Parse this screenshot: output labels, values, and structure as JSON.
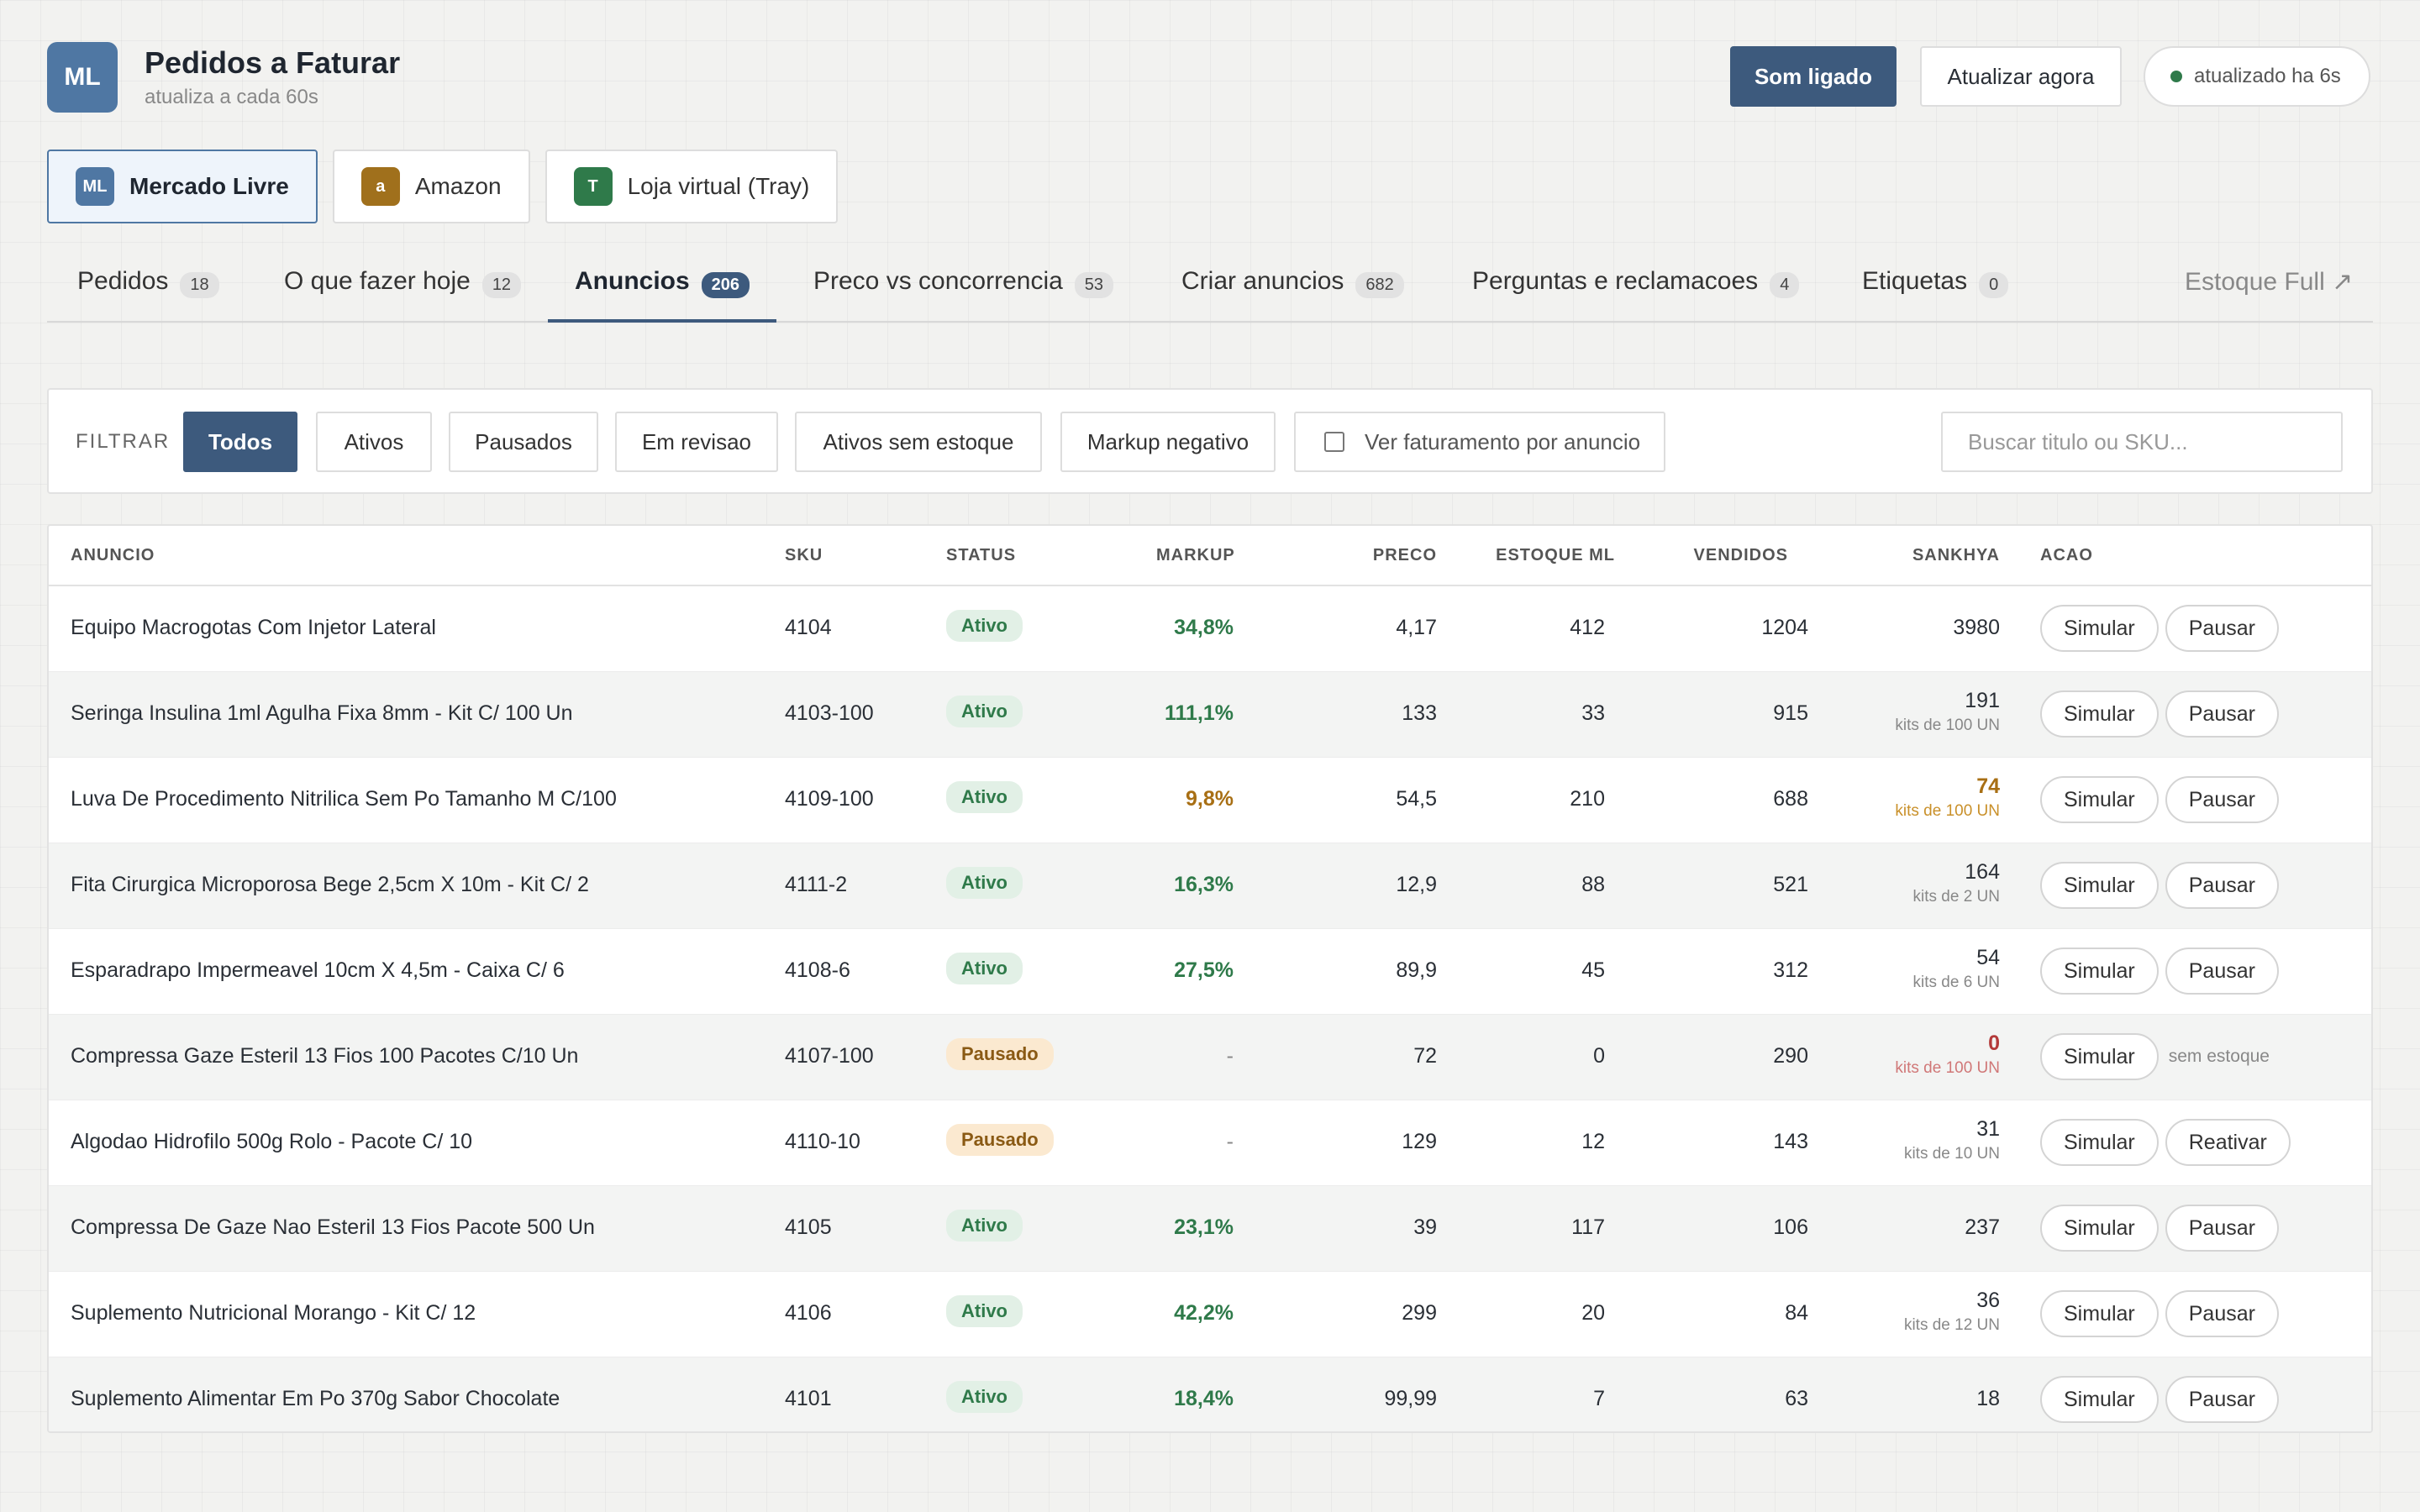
{
  "header": {
    "logo": "ML",
    "title": "Pedidos a Faturar",
    "subtitle": "atualiza a cada 60s",
    "sound_button": "Som ligado",
    "refresh_button": "Atualizar agora",
    "status_text": "atualizado ha 6s"
  },
  "marketplaces": [
    {
      "icon": "ML",
      "label": "Mercado Livre",
      "color": "#4f77a3",
      "active": true
    },
    {
      "icon": "a",
      "label": "Amazon",
      "color": "#a0701c",
      "active": false
    },
    {
      "icon": "T",
      "label": "Loja virtual (Tray)",
      "color": "#2f7a4a",
      "active": false
    }
  ],
  "tabs": [
    {
      "label": "Pedidos",
      "count": "18"
    },
    {
      "label": "O que fazer hoje",
      "count": "12"
    },
    {
      "label": "Anuncios",
      "count": "206"
    },
    {
      "label": "Preco vs concorrencia",
      "count": "53"
    },
    {
      "label": "Criar anuncios",
      "count": "682"
    },
    {
      "label": "Perguntas e reclamacoes",
      "count": "4"
    },
    {
      "label": "Etiquetas",
      "count": "0"
    },
    {
      "label": "Estoque Full ↗"
    }
  ],
  "filters": {
    "label": "FILTRAR",
    "buttons": [
      "Todos",
      "Ativos",
      "Pausados",
      "Em revisao",
      "Ativos sem estoque",
      "Markup negativo"
    ],
    "checkbox_label": "Ver faturamento por anuncio",
    "search_placeholder": "Buscar titulo ou SKU..."
  },
  "table": {
    "headers": [
      "ANUNCIO",
      "SKU",
      "STATUS",
      "MARKUP",
      "PRECO",
      "ESTOQUE ML",
      "VENDIDOS",
      "SANKHYA",
      "ACAO"
    ],
    "rows": [
      {
        "name": "Equipo Macrogotas Com Injetor Lateral",
        "sku": "4104",
        "status": "Ativo",
        "markup": "34,8%",
        "preco": "4,17",
        "estoque": "412",
        "vendidos": "1204",
        "sankhya": "3980",
        "sankhya_sub": "",
        "action1": "Simular",
        "action2": "Pausar"
      },
      {
        "name": "Seringa Insulina 1ml Agulha Fixa 8mm - Kit C/ 100 Un",
        "sku": "4103-100",
        "status": "Ativo",
        "markup": "111,1%",
        "preco": "133",
        "estoque": "33",
        "vendidos": "915",
        "sankhya": "191",
        "sankhya_sub": "kits de 100 UN",
        "action1": "Simular",
        "action2": "Pausar"
      },
      {
        "name": "Luva De Procedimento Nitrilica Sem Po Tamanho M C/100",
        "sku": "4109-100",
        "status": "Ativo",
        "markup": "9,8%",
        "preco": "54,5",
        "estoque": "210",
        "vendidos": "688",
        "sankhya": "74",
        "sankhya_sub": "kits de 100 UN",
        "action1": "Simular",
        "action2": "Pausar"
      },
      {
        "name": "Fita Cirurgica Microporosa Bege 2,5cm X 10m - Kit C/ 2",
        "sku": "4111-2",
        "status": "Ativo",
        "markup": "16,3%",
        "preco": "12,9",
        "estoque": "88",
        "vendidos": "521",
        "sankhya": "164",
        "sankhya_sub": "kits de 2 UN",
        "action1": "Simular",
        "action2": "Pausar"
      },
      {
        "name": "Esparadrapo Impermeavel 10cm X 4,5m - Caixa C/ 6",
        "sku": "4108-6",
        "status": "Ativo",
        "markup": "27,5%",
        "preco": "89,9",
        "estoque": "45",
        "vendidos": "312",
        "sankhya": "54",
        "sankhya_sub": "kits de 6 UN",
        "action1": "Simular",
        "action2": "Pausar"
      },
      {
        "name": "Compressa Gaze Esteril 13 Fios 100 Pacotes C/10 Un",
        "sku": "4107-100",
        "status": "Pausado",
        "markup": "-",
        "preco": "72",
        "estoque": "0",
        "vendidos": "290",
        "sankhya": "0",
        "sankhya_sub": "kits de 100 UN",
        "action1": "Simular",
        "action2": "",
        "note": "sem estoque"
      },
      {
        "name": "Algodao Hidrofilo 500g Rolo - Pacote C/ 10",
        "sku": "4110-10",
        "status": "Pausado",
        "markup": "-",
        "preco": "129",
        "estoque": "12",
        "vendidos": "143",
        "sankhya": "31",
        "sankhya_sub": "kits de 10 UN",
        "action1": "Simular",
        "action2": "Reativar"
      },
      {
        "name": "Compressa De Gaze Nao Esteril 13 Fios Pacote 500 Un",
        "sku": "4105",
        "status": "Ativo",
        "markup": "23,1%",
        "preco": "39",
        "estoque": "117",
        "vendidos": "106",
        "sankhya": "237",
        "sankhya_sub": "",
        "action1": "Simular",
        "action2": "Pausar"
      },
      {
        "name": "Suplemento Nutricional Morango - Kit C/ 12",
        "sku": "4106",
        "status": "Ativo",
        "markup": "42,2%",
        "preco": "299",
        "estoque": "20",
        "vendidos": "84",
        "sankhya": "36",
        "sankhya_sub": "kits de 12 UN",
        "action1": "Simular",
        "action2": "Pausar"
      },
      {
        "name": "Suplemento Alimentar Em Po 370g Sabor Chocolate",
        "sku": "4101",
        "status": "Ativo",
        "markup": "18,4%",
        "preco": "99,99",
        "estoque": "7",
        "vendidos": "63",
        "sankhya": "18",
        "sankhya_sub": "",
        "action1": "Simular",
        "action2": "Pausar"
      }
    ]
  }
}
